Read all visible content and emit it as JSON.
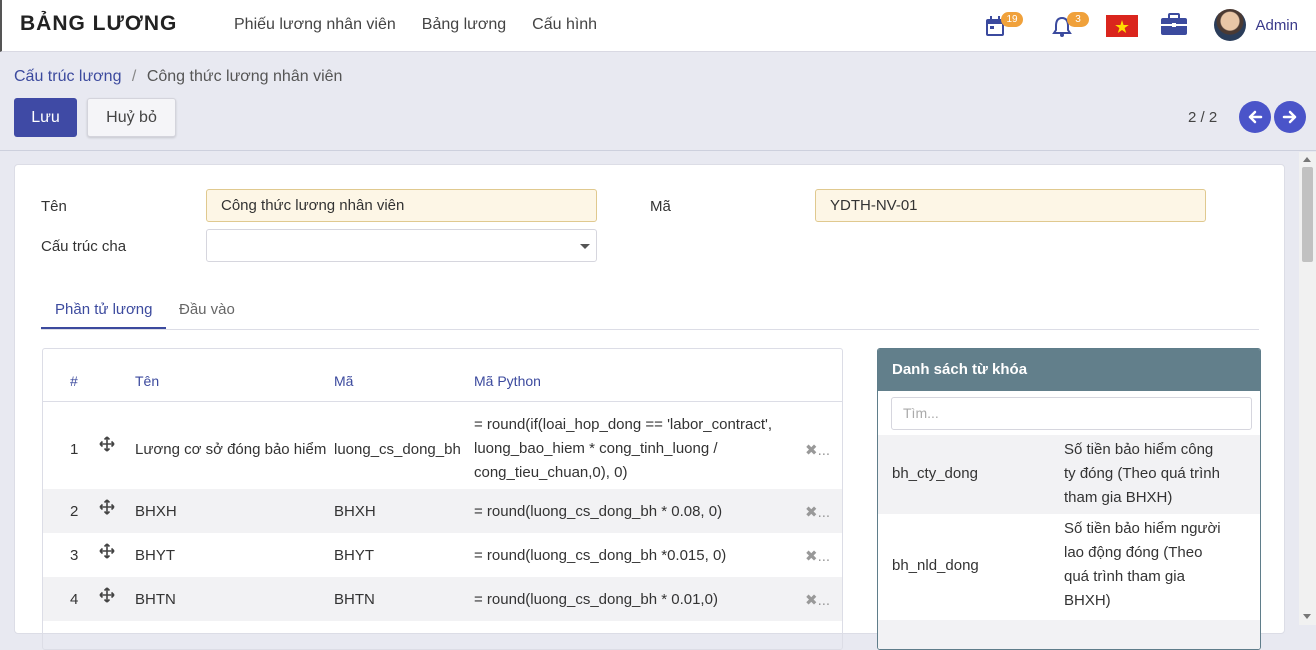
{
  "app": {
    "title": "BẢNG LƯƠNG"
  },
  "nav": {
    "items": [
      "Phiếu lương nhân viên",
      "Bảng lương",
      "Cấu hình"
    ],
    "calendar_badge": "19",
    "notification_badge": "3",
    "user_name": "Admin"
  },
  "breadcrumb": {
    "parent": "Cấu trúc lương",
    "separator": "/",
    "current": "Công thức lương nhân viên"
  },
  "buttons": {
    "save": "Lưu",
    "discard": "Huỷ bỏ"
  },
  "pager": {
    "value": "2 / 2"
  },
  "form": {
    "name_label": "Tên",
    "name_value": "Công thức lương nhân viên",
    "code_label": "Mã",
    "code_value": "YDTH-NV-01",
    "parent_label": "Cấu trúc cha",
    "parent_value": ""
  },
  "tabs": [
    "Phần tử lương",
    "Đầu vào"
  ],
  "table": {
    "headers": {
      "num": "#",
      "name": "Tên",
      "code": "Mã",
      "python": "Mã Python"
    },
    "rows": [
      {
        "num": "1",
        "name": "Lương cơ sở đóng bảo hiểm",
        "code": "luong_cs_dong_bh",
        "python": [
          "= round(if(loai_hop_dong == 'labor_contract',",
          "luong_bao_hiem * cong_tinh_luong /",
          "cong_tieu_chuan,0), 0)"
        ]
      },
      {
        "num": "2",
        "name": "BHXH",
        "code": "BHXH",
        "python": [
          "= round(luong_cs_dong_bh * 0.08, 0)"
        ]
      },
      {
        "num": "3",
        "name": "BHYT",
        "code": "BHYT",
        "python": [
          "= round(luong_cs_dong_bh *0.015, 0)"
        ]
      },
      {
        "num": "4",
        "name": "BHTN",
        "code": "BHTN",
        "python": [
          "= round(luong_cs_dong_bh * 0.01,0)"
        ]
      }
    ],
    "delete_glyph": "✖..."
  },
  "keywords": {
    "title": "Danh sách từ khóa",
    "search_placeholder": "Tìm...",
    "items": [
      {
        "key": "bh_cty_dong",
        "desc": [
          "Số tiền bảo hiểm công",
          "ty đóng (Theo quá trình",
          "tham gia BHXH)"
        ]
      },
      {
        "key": "bh_nld_dong",
        "desc": [
          "Số tiền bảo hiểm người",
          "lao động đóng (Theo",
          "quá trình tham gia",
          "BHXH)"
        ]
      }
    ]
  },
  "colors": {
    "primary": "#3f4aa5",
    "badge": "#f0a13b",
    "panel_header": "#627f8b",
    "required_field": "#fdf6e6"
  }
}
